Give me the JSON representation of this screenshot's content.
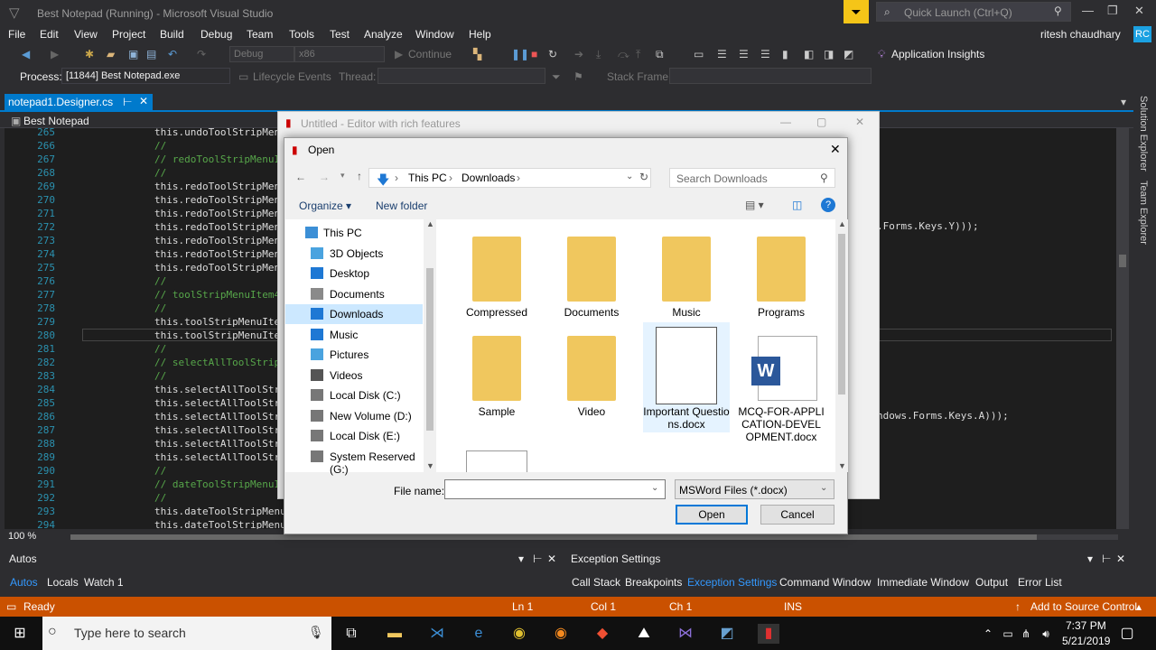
{
  "vs": {
    "title": "Best Notepad (Running) - Microsoft Visual Studio",
    "quick_launch": "Quick Launch (Ctrl+Q)",
    "user": "ritesh chaudhary",
    "user_initials": "RC",
    "menu": [
      "File",
      "Edit",
      "View",
      "Project",
      "Build",
      "Debug",
      "Team",
      "Tools",
      "Test",
      "Analyze",
      "Window",
      "Help"
    ],
    "toolbar": {
      "config": "Debug",
      "platform": "x86",
      "continue": "Continue",
      "app_insights": "Application Insights"
    },
    "toolbar2": {
      "process_label": "Process:",
      "process": "[11844] Best Notepad.exe",
      "lifecycle": "Lifecycle Events",
      "thread": "Thread:",
      "stack": "Stack Frame:"
    },
    "doc_tab": "notepad1.Designer.cs",
    "class_path": "Best Notepad",
    "side_tabs": [
      "Solution Explorer",
      "Team Explorer"
    ],
    "zoom": "100 %",
    "code_lines": [
      {
        "n": "265",
        "t": "this.undoToolStripMenu",
        "c": "tx"
      },
      {
        "n": "266",
        "t": "//",
        "c": "cm"
      },
      {
        "n": "267",
        "t": "// redoToolStripMenuI",
        "c": "cm"
      },
      {
        "n": "268",
        "t": "//",
        "c": "cm"
      },
      {
        "n": "269",
        "t": "this.redoToolStripMen",
        "c": "tx"
      },
      {
        "n": "270",
        "t": "this.redoToolStripMen",
        "c": "tx"
      },
      {
        "n": "271",
        "t": "this.redoToolStripMen",
        "c": "tx"
      },
      {
        "n": "272",
        "t": "this.redoToolStripMen",
        "c": "tx"
      },
      {
        "n": "273",
        "t": "this.redoToolStripMen",
        "c": "tx"
      },
      {
        "n": "274",
        "t": "this.redoToolStripMen",
        "c": "tx"
      },
      {
        "n": "275",
        "t": "this.redoToolStripMen",
        "c": "tx"
      },
      {
        "n": "276",
        "t": "//",
        "c": "cm"
      },
      {
        "n": "277",
        "t": "// toolStripMenuItem4",
        "c": "cm"
      },
      {
        "n": "278",
        "t": "//",
        "c": "cm"
      },
      {
        "n": "279",
        "t": "this.toolStripMenuIte",
        "c": "tx"
      },
      {
        "n": "280",
        "t": "this.toolStripMenuIte",
        "c": "tx"
      },
      {
        "n": "281",
        "t": "//",
        "c": "cm"
      },
      {
        "n": "282",
        "t": "// selectAllToolStrip",
        "c": "cm"
      },
      {
        "n": "283",
        "t": "//",
        "c": "cm"
      },
      {
        "n": "284",
        "t": "this.selectAllToolStr",
        "c": "tx"
      },
      {
        "n": "285",
        "t": "this.selectAllToolStr",
        "c": "tx"
      },
      {
        "n": "286",
        "t": "this.selectAllToolStr",
        "c": "tx"
      },
      {
        "n": "287",
        "t": "this.selectAllToolStr",
        "c": "tx"
      },
      {
        "n": "288",
        "t": "this.selectAllToolStr",
        "c": "tx"
      },
      {
        "n": "289",
        "t": "this.selectAllToolStr",
        "c": "tx"
      },
      {
        "n": "290",
        "t": "//",
        "c": "cm"
      },
      {
        "n": "291",
        "t": "// dateToolStripMenuI",
        "c": "cm"
      },
      {
        "n": "292",
        "t": "//",
        "c": "cm"
      },
      {
        "n": "293",
        "t": "this.dateToolStripMenu",
        "c": "tx"
      },
      {
        "n": "294",
        "t": "this.dateToolStripMenu",
        "c": "tx"
      }
    ],
    "right_code": {
      "keys_y": ".Forms.Keys.Y)));",
      "keys_a": "ndows.Forms.Keys.A)));"
    },
    "autos": {
      "title": "Autos",
      "tabs": [
        "Autos",
        "Locals",
        "Watch 1"
      ]
    },
    "exceptions": {
      "title": "Exception Settings",
      "tabs": [
        "Call Stack",
        "Breakpoints",
        "Exception Settings",
        "Command Window",
        "Immediate Window",
        "Output",
        "Error List"
      ]
    },
    "status": {
      "ready": "Ready",
      "ln": "Ln 1",
      "col": "Col 1",
      "ch": "Ch 1",
      "ins": "INS",
      "source_control": "Add to Source Control"
    }
  },
  "app_window": {
    "title": "Untitled - Editor with rich features"
  },
  "dialog": {
    "title": "Open",
    "breadcrumb": [
      "This PC",
      "Downloads"
    ],
    "search_placeholder": "Search Downloads",
    "organize": "Organize",
    "new_folder": "New folder",
    "nav": [
      {
        "label": "This PC",
        "icon": "pc-icon",
        "color": "#3c8fd6"
      },
      {
        "label": "3D Objects",
        "icon": "cube-icon",
        "color": "#4aa3df"
      },
      {
        "label": "Desktop",
        "icon": "desktop-icon",
        "color": "#1e78d4"
      },
      {
        "label": "Documents",
        "icon": "document-icon",
        "color": "#8a8a8a"
      },
      {
        "label": "Downloads",
        "icon": "download-icon",
        "color": "#1e78d4"
      },
      {
        "label": "Music",
        "icon": "music-icon",
        "color": "#1e78d4"
      },
      {
        "label": "Pictures",
        "icon": "pictures-icon",
        "color": "#4aa3df"
      },
      {
        "label": "Videos",
        "icon": "video-icon",
        "color": "#555555"
      },
      {
        "label": "Local Disk (C:)",
        "icon": "drive-icon",
        "color": "#777777"
      },
      {
        "label": "New Volume (D:)",
        "icon": "drive-icon",
        "color": "#777777"
      },
      {
        "label": "Local Disk (E:)",
        "icon": "drive-icon",
        "color": "#777777"
      },
      {
        "label": "System Reserved (G:)",
        "icon": "drive-icon",
        "color": "#777777"
      }
    ],
    "files": [
      {
        "label": "Compressed",
        "kind": "folder"
      },
      {
        "label": "Documents",
        "kind": "folder"
      },
      {
        "label": "Music",
        "kind": "folder"
      },
      {
        "label": "Programs",
        "kind": "folder"
      },
      {
        "label": "Sample",
        "kind": "folder"
      },
      {
        "label": "Video",
        "kind": "folder"
      },
      {
        "label": "Important Questions.docx",
        "kind": "docx-thumb"
      },
      {
        "label": "MCQ-FOR-APPLICATION-DEVELOPMENT.docx",
        "kind": "word"
      }
    ],
    "file_name_label": "File name:",
    "file_name_value": "",
    "file_type": "MSWord Files (*.docx)",
    "open_button": "Open",
    "cancel_button": "Cancel"
  },
  "taskbar": {
    "search_placeholder": "Type here to search",
    "time": "7:37 PM",
    "date": "5/21/2019"
  },
  "colors": {
    "vs_accent": "#007acc",
    "status_debug": "#ca5100",
    "folder": "#f0c75e"
  }
}
